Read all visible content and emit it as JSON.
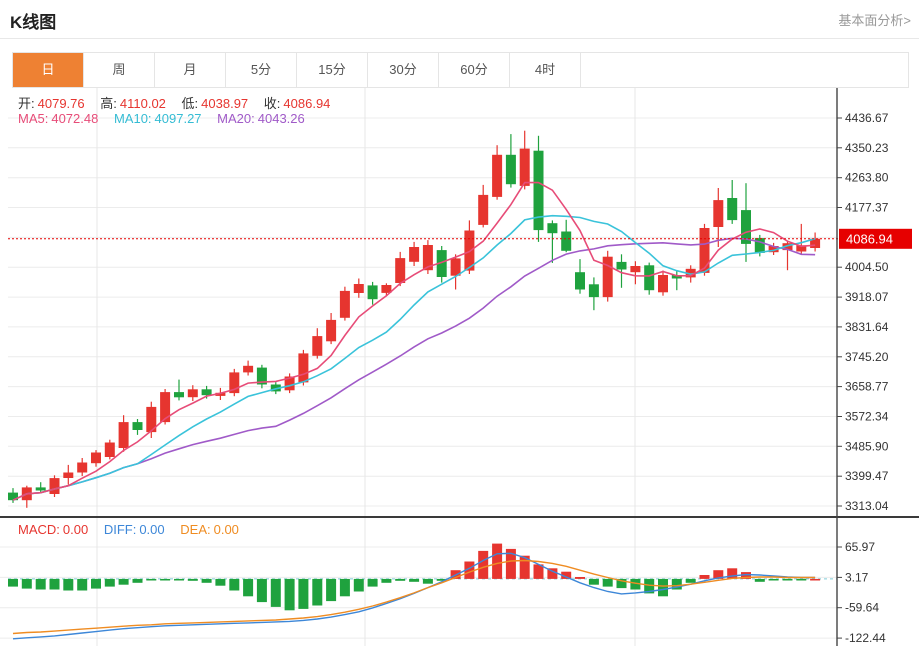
{
  "header": {
    "title": "K线图",
    "link": "基本面分析>"
  },
  "tabs": {
    "items": [
      "日",
      "周",
      "月",
      "5分",
      "15分",
      "30分",
      "60分",
      "4时"
    ],
    "active": "日",
    "active_index": 0
  },
  "ohlc": {
    "open_label": "开:",
    "open": "4079.76",
    "high_label": "高:",
    "high": "4110.02",
    "low_label": "低:",
    "low": "4038.97",
    "close_label": "收:",
    "close": "4086.94"
  },
  "ma_legend": {
    "ma5_label": "MA5:",
    "ma5": "4072.48",
    "ma10_label": "MA10:",
    "ma10": "4097.27",
    "ma20_label": "MA20:",
    "ma20": "4043.26"
  },
  "macd_legend": {
    "macd_label": "MACD:",
    "macd": "0.00",
    "diff_label": "DIFF:",
    "diff": "0.00",
    "dea_label": "DEA:",
    "dea": "0.00"
  },
  "price_marker": {
    "value": "4086.94"
  },
  "colors": {
    "up": "#e6352f",
    "down": "#1fa23e",
    "ma5": "#e74c78",
    "ma10": "#3ac3da",
    "ma20": "#a05ac8",
    "diff": "#3d87d8",
    "dea": "#ef8c22",
    "marker_bg": "#e60000",
    "tab_active_bg": "#ee8133",
    "grid": "#ececec",
    "vgrid": "#e7e7e7",
    "axis": "#444444",
    "zero_dash": "#7fccd8",
    "dotted_price_line": "#e60000"
  },
  "chart_data": [
    {
      "type": "candlestick",
      "title": "K线图 (daily)",
      "y_ticks": [
        "4436.67",
        "4350.23",
        "4263.80",
        "4177.37",
        "4004.50",
        "3918.07",
        "3831.64",
        "3745.20",
        "3658.77",
        "3572.34",
        "3485.90",
        "3399.47",
        "3313.04"
      ],
      "ylim": [
        3313.04,
        4436.67
      ],
      "current_price": 4086.94,
      "grid": true,
      "legend_position": "top-left",
      "ohlc_note": "values are [open, high, low, close]; close>=open renders red (up), close<open renders green (down)",
      "candles": [
        [
          3352,
          3365,
          3322,
          3330
        ],
        [
          3330,
          3372,
          3308,
          3367
        ],
        [
          3367,
          3382,
          3350,
          3358
        ],
        [
          3348,
          3402,
          3339,
          3394
        ],
        [
          3394,
          3432,
          3375,
          3410
        ],
        [
          3410,
          3452,
          3400,
          3439
        ],
        [
          3437,
          3475,
          3427,
          3468
        ],
        [
          3455,
          3505,
          3448,
          3497
        ],
        [
          3481,
          3576,
          3470,
          3556
        ],
        [
          3556,
          3565,
          3519,
          3533
        ],
        [
          3527,
          3615,
          3510,
          3600
        ],
        [
          3556,
          3652,
          3549,
          3643
        ],
        [
          3643,
          3679,
          3619,
          3628
        ],
        [
          3628,
          3663,
          3617,
          3651
        ],
        [
          3651,
          3661,
          3624,
          3634
        ],
        [
          3632,
          3655,
          3620,
          3641
        ],
        [
          3640,
          3710,
          3631,
          3700
        ],
        [
          3700,
          3734,
          3691,
          3719
        ],
        [
          3714,
          3722,
          3654,
          3665
        ],
        [
          3665,
          3672,
          3637,
          3645
        ],
        [
          3648,
          3697,
          3640,
          3688
        ],
        [
          3671,
          3765,
          3662,
          3755
        ],
        [
          3748,
          3828,
          3740,
          3805
        ],
        [
          3790,
          3872,
          3782,
          3852
        ],
        [
          3858,
          3948,
          3850,
          3936
        ],
        [
          3930,
          3972,
          3916,
          3956
        ],
        [
          3952,
          3962,
          3896,
          3912
        ],
        [
          3930,
          3958,
          3920,
          3953
        ],
        [
          3959,
          4049,
          3950,
          4031
        ],
        [
          4020,
          4078,
          4008,
          4063
        ],
        [
          3996,
          4083,
          3985,
          4069
        ],
        [
          4054,
          4066,
          3960,
          3976
        ],
        [
          3980,
          4042,
          3940,
          4030
        ],
        [
          3995,
          4140,
          3985,
          4111
        ],
        [
          4127,
          4243,
          4120,
          4214
        ],
        [
          4208,
          4358,
          4200,
          4330
        ],
        [
          4330,
          4390,
          4235,
          4245
        ],
        [
          4240,
          4400,
          4230,
          4348
        ],
        [
          4342,
          4385,
          4078,
          4112
        ],
        [
          4132,
          4140,
          4017,
          4103
        ],
        [
          4108,
          4142,
          4048,
          4052
        ],
        [
          3990,
          4028,
          3928,
          3940
        ],
        [
          3955,
          3975,
          3880,
          3918
        ],
        [
          3918,
          4052,
          3905,
          4035
        ],
        [
          4020,
          4042,
          3945,
          3998
        ],
        [
          3990,
          4022,
          3955,
          4008
        ],
        [
          4010,
          4018,
          3925,
          3938
        ],
        [
          3932,
          3995,
          3922,
          3982
        ],
        [
          3982,
          3995,
          3938,
          3972
        ],
        [
          3975,
          4010,
          3960,
          4000
        ],
        [
          3988,
          4130,
          3980,
          4118
        ],
        [
          4121,
          4234,
          4063,
          4199
        ],
        [
          4205,
          4257,
          4130,
          4141
        ],
        [
          4170,
          4248,
          4020,
          4072
        ],
        [
          4089,
          4098,
          4036,
          4046
        ],
        [
          4048,
          4075,
          4040,
          4066
        ],
        [
          4054,
          4080,
          3996,
          4074
        ],
        [
          4050,
          4130,
          4042,
          4068
        ],
        [
          4060,
          4105,
          4050,
          4087
        ]
      ],
      "ma_windows": [
        5,
        10,
        20
      ]
    },
    {
      "type": "bar",
      "title": "MACD",
      "y_ticks": [
        "65.97",
        "3.17",
        "-59.64",
        "-122.44"
      ],
      "ylim": [
        -122.44,
        65.97
      ],
      "grid": true,
      "histogram": [
        -16,
        -20,
        -22,
        -22,
        -24,
        -24,
        -20,
        -16,
        -12,
        -8,
        -3,
        -2,
        -3,
        -4,
        -8,
        -14,
        -24,
        -36,
        -48,
        -58,
        -65,
        -62,
        -55,
        -46,
        -36,
        -26,
        -16,
        -8,
        -4,
        -6,
        -10,
        -4,
        18,
        36,
        58,
        73,
        62,
        48,
        30,
        22,
        15,
        4,
        -12,
        -16,
        -19,
        -22,
        -30,
        -36,
        -22,
        -8,
        8,
        18,
        22,
        14,
        -6,
        -3,
        -2,
        -1,
        0
      ],
      "series": [
        {
          "name": "DIFF",
          "values": [
            -124,
            -122,
            -120,
            -118,
            -115,
            -112,
            -109,
            -106,
            -103,
            -101,
            -99,
            -97,
            -96,
            -95,
            -94,
            -93,
            -92,
            -91,
            -90,
            -89,
            -88,
            -86,
            -83,
            -79,
            -74,
            -68,
            -60,
            -51,
            -41,
            -30,
            -18,
            -6,
            8,
            22,
            38,
            52,
            53,
            44,
            30,
            16,
            4,
            -8,
            -18,
            -26,
            -31,
            -29,
            -26,
            -22,
            -17,
            -11,
            -4,
            2,
            6,
            9,
            8,
            6,
            4,
            3,
            3
          ]
        },
        {
          "name": "DEA",
          "values": [
            -113,
            -111,
            -110,
            -108,
            -106,
            -104,
            -102,
            -100,
            -98,
            -96,
            -95,
            -93,
            -92,
            -91,
            -90,
            -89,
            -88,
            -87,
            -86,
            -85,
            -83,
            -81,
            -78,
            -74,
            -69,
            -63,
            -56,
            -48,
            -39,
            -29,
            -18,
            -8,
            3,
            14,
            24,
            32,
            37,
            38,
            36,
            32,
            26,
            18,
            10,
            3,
            -4,
            -9,
            -13,
            -15,
            -14,
            -11,
            -7,
            -3,
            1,
            3,
            4,
            4,
            3,
            3,
            3
          ]
        }
      ]
    }
  ]
}
